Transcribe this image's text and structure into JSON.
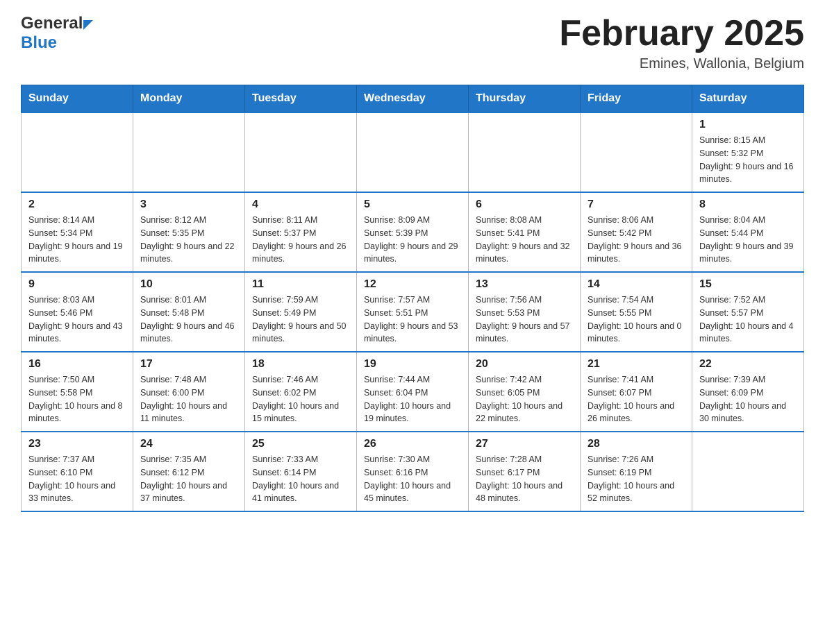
{
  "header": {
    "logo_general": "General",
    "logo_blue": "Blue",
    "month_title": "February 2025",
    "location": "Emines, Wallonia, Belgium"
  },
  "days_of_week": [
    "Sunday",
    "Monday",
    "Tuesday",
    "Wednesday",
    "Thursday",
    "Friday",
    "Saturday"
  ],
  "weeks": [
    [
      {
        "day": "",
        "info": ""
      },
      {
        "day": "",
        "info": ""
      },
      {
        "day": "",
        "info": ""
      },
      {
        "day": "",
        "info": ""
      },
      {
        "day": "",
        "info": ""
      },
      {
        "day": "",
        "info": ""
      },
      {
        "day": "1",
        "info": "Sunrise: 8:15 AM\nSunset: 5:32 PM\nDaylight: 9 hours and 16 minutes."
      }
    ],
    [
      {
        "day": "2",
        "info": "Sunrise: 8:14 AM\nSunset: 5:34 PM\nDaylight: 9 hours and 19 minutes."
      },
      {
        "day": "3",
        "info": "Sunrise: 8:12 AM\nSunset: 5:35 PM\nDaylight: 9 hours and 22 minutes."
      },
      {
        "day": "4",
        "info": "Sunrise: 8:11 AM\nSunset: 5:37 PM\nDaylight: 9 hours and 26 minutes."
      },
      {
        "day": "5",
        "info": "Sunrise: 8:09 AM\nSunset: 5:39 PM\nDaylight: 9 hours and 29 minutes."
      },
      {
        "day": "6",
        "info": "Sunrise: 8:08 AM\nSunset: 5:41 PM\nDaylight: 9 hours and 32 minutes."
      },
      {
        "day": "7",
        "info": "Sunrise: 8:06 AM\nSunset: 5:42 PM\nDaylight: 9 hours and 36 minutes."
      },
      {
        "day": "8",
        "info": "Sunrise: 8:04 AM\nSunset: 5:44 PM\nDaylight: 9 hours and 39 minutes."
      }
    ],
    [
      {
        "day": "9",
        "info": "Sunrise: 8:03 AM\nSunset: 5:46 PM\nDaylight: 9 hours and 43 minutes."
      },
      {
        "day": "10",
        "info": "Sunrise: 8:01 AM\nSunset: 5:48 PM\nDaylight: 9 hours and 46 minutes."
      },
      {
        "day": "11",
        "info": "Sunrise: 7:59 AM\nSunset: 5:49 PM\nDaylight: 9 hours and 50 minutes."
      },
      {
        "day": "12",
        "info": "Sunrise: 7:57 AM\nSunset: 5:51 PM\nDaylight: 9 hours and 53 minutes."
      },
      {
        "day": "13",
        "info": "Sunrise: 7:56 AM\nSunset: 5:53 PM\nDaylight: 9 hours and 57 minutes."
      },
      {
        "day": "14",
        "info": "Sunrise: 7:54 AM\nSunset: 5:55 PM\nDaylight: 10 hours and 0 minutes."
      },
      {
        "day": "15",
        "info": "Sunrise: 7:52 AM\nSunset: 5:57 PM\nDaylight: 10 hours and 4 minutes."
      }
    ],
    [
      {
        "day": "16",
        "info": "Sunrise: 7:50 AM\nSunset: 5:58 PM\nDaylight: 10 hours and 8 minutes."
      },
      {
        "day": "17",
        "info": "Sunrise: 7:48 AM\nSunset: 6:00 PM\nDaylight: 10 hours and 11 minutes."
      },
      {
        "day": "18",
        "info": "Sunrise: 7:46 AM\nSunset: 6:02 PM\nDaylight: 10 hours and 15 minutes."
      },
      {
        "day": "19",
        "info": "Sunrise: 7:44 AM\nSunset: 6:04 PM\nDaylight: 10 hours and 19 minutes."
      },
      {
        "day": "20",
        "info": "Sunrise: 7:42 AM\nSunset: 6:05 PM\nDaylight: 10 hours and 22 minutes."
      },
      {
        "day": "21",
        "info": "Sunrise: 7:41 AM\nSunset: 6:07 PM\nDaylight: 10 hours and 26 minutes."
      },
      {
        "day": "22",
        "info": "Sunrise: 7:39 AM\nSunset: 6:09 PM\nDaylight: 10 hours and 30 minutes."
      }
    ],
    [
      {
        "day": "23",
        "info": "Sunrise: 7:37 AM\nSunset: 6:10 PM\nDaylight: 10 hours and 33 minutes."
      },
      {
        "day": "24",
        "info": "Sunrise: 7:35 AM\nSunset: 6:12 PM\nDaylight: 10 hours and 37 minutes."
      },
      {
        "day": "25",
        "info": "Sunrise: 7:33 AM\nSunset: 6:14 PM\nDaylight: 10 hours and 41 minutes."
      },
      {
        "day": "26",
        "info": "Sunrise: 7:30 AM\nSunset: 6:16 PM\nDaylight: 10 hours and 45 minutes."
      },
      {
        "day": "27",
        "info": "Sunrise: 7:28 AM\nSunset: 6:17 PM\nDaylight: 10 hours and 48 minutes."
      },
      {
        "day": "28",
        "info": "Sunrise: 7:26 AM\nSunset: 6:19 PM\nDaylight: 10 hours and 52 minutes."
      },
      {
        "day": "",
        "info": ""
      }
    ]
  ]
}
